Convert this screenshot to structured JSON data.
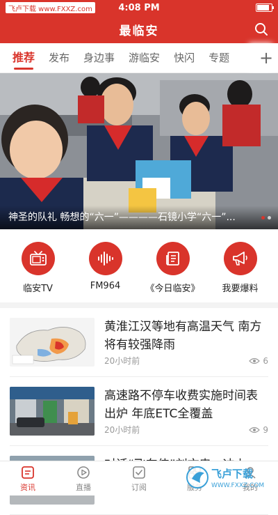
{
  "status_bar": {
    "carrier": "飞卢下载 www.FXXZ.com",
    "time": "4:08 PM"
  },
  "header": {
    "title": "最临安"
  },
  "tabs": [
    "推荐",
    "发布",
    "身边事",
    "游临安",
    "快闪",
    "专题"
  ],
  "active_tab": 0,
  "banner": {
    "caption": "神圣的队礼 畅想的“六一”————石镜小学“六一”...",
    "slides": 2,
    "current": 0
  },
  "quick_links": [
    {
      "label": "临安TV",
      "icon": "tv-icon"
    },
    {
      "label": "FM964",
      "icon": "audio-wave-icon"
    },
    {
      "label": "《今日临安》",
      "icon": "newspaper-icon"
    },
    {
      "label": "我要爆料",
      "icon": "megaphone-icon"
    }
  ],
  "news": [
    {
      "title": "黄淮江汉等地有高温天气 南方将有较强降雨",
      "time": "20小时前",
      "views": "6",
      "thumb": "weather-map"
    },
    {
      "title": "高速路不停车收费实施时间表出炉 年底ETC全覆盖",
      "time": "20小时前",
      "views": "9",
      "thumb": "toll-station"
    },
    {
      "title": "对话“飞车侠”刘文忠：冲上",
      "time": "",
      "views": "",
      "thumb": "street"
    }
  ],
  "bottom_nav": [
    {
      "label": "资讯",
      "icon": "news-icon"
    },
    {
      "label": "直播",
      "icon": "play-icon"
    },
    {
      "label": "订阅",
      "icon": "subscribe-icon"
    },
    {
      "label": "服务",
      "icon": "service-icon"
    },
    {
      "label": "我的",
      "icon": "profile-icon"
    }
  ],
  "active_nav": 0,
  "watermark": {
    "text": "飞卢下载",
    "url": "WWW.FXXZ.COM"
  },
  "colors": {
    "brand": "#d9342b"
  }
}
